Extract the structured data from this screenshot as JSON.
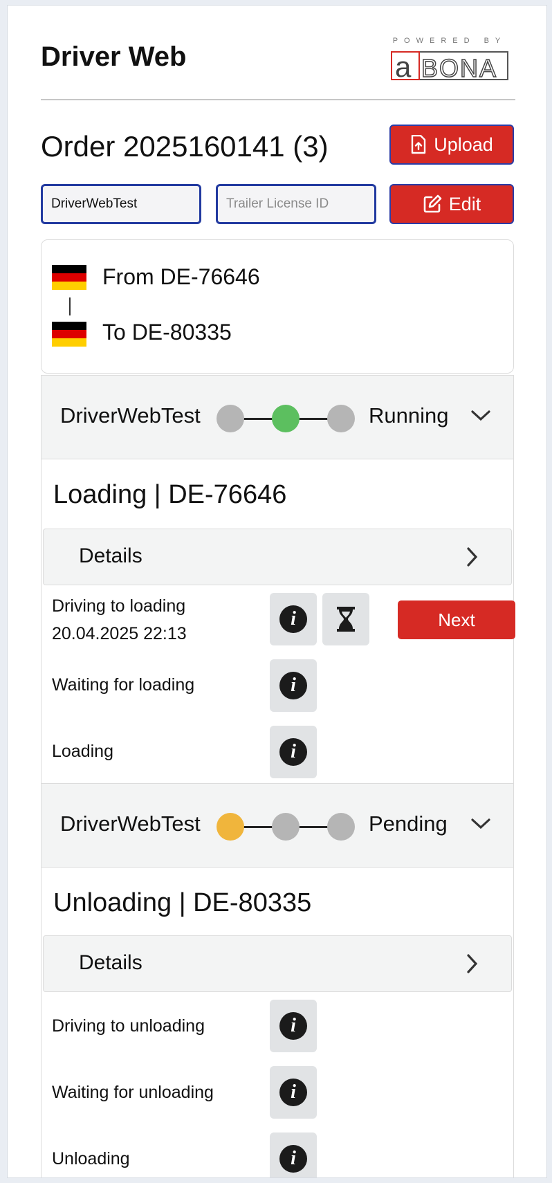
{
  "app": {
    "title": "Driver Web",
    "logo_top": "POWERED BY",
    "logo_text": "aBONA"
  },
  "order": {
    "title": "Order 2025160141 (3)",
    "upload_label": "Upload",
    "edit_label": "Edit"
  },
  "inputs": {
    "driver_value": "DriverWebTest",
    "trailer_placeholder": "Trailer License ID"
  },
  "route": {
    "from": "From DE-76646",
    "to": "To DE-80335",
    "from_flag": "germany-flag-icon",
    "to_flag": "germany-flag-icon"
  },
  "sections": [
    {
      "driver": "DriverWebTest",
      "status": "Running",
      "progress_colors": [
        "#b5b5b5",
        "#5cbf5f",
        "#b5b5b5"
      ],
      "title": "Loading | DE-76646",
      "details_label": "Details",
      "steps": [
        {
          "label": "Driving to loading",
          "timestamp": "20.04.2025 22:13"
        },
        {
          "label": "Waiting for loading"
        },
        {
          "label": "Loading"
        }
      ],
      "next_label": "Next"
    },
    {
      "driver": "DriverWebTest",
      "status": "Pending",
      "progress_colors": [
        "#f0b53c",
        "#b5b5b5",
        "#b5b5b5"
      ],
      "title": "Unloading | DE-80335",
      "details_label": "Details",
      "steps": [
        {
          "label": "Driving to unloading"
        },
        {
          "label": "Waiting for unloading"
        },
        {
          "label": "Unloading"
        }
      ]
    }
  ],
  "colors": {
    "accent_red": "#d62a24",
    "border_blue": "#2b3ca6",
    "flag_black": "#000000",
    "flag_red": "#dd0000",
    "flag_gold": "#ffce00"
  }
}
